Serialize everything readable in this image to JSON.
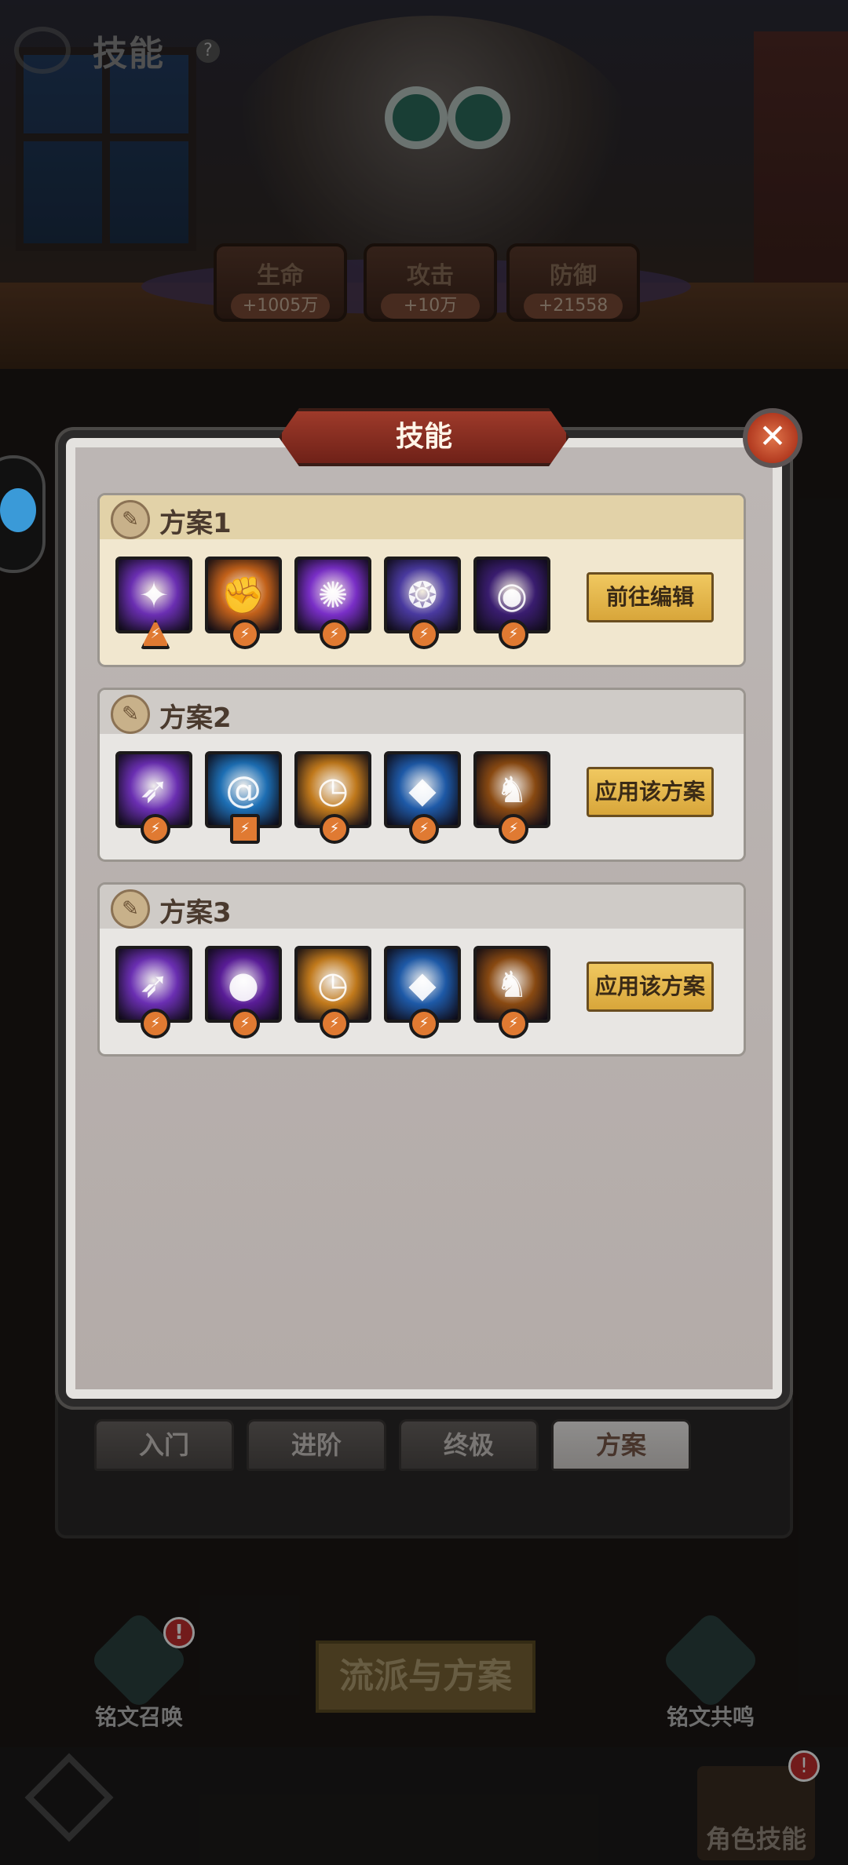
{
  "header": {
    "title": "技能",
    "help_label": "?"
  },
  "stats": [
    {
      "label": "生命",
      "value": "+1005万"
    },
    {
      "label": "攻击",
      "value": "+10万"
    },
    {
      "label": "防御",
      "value": "+21558"
    }
  ],
  "modal": {
    "title": "技能",
    "close_label": "✕",
    "plans": [
      {
        "name": "方案1",
        "action": "前往编辑",
        "active": true,
        "skills": [
          {
            "icon": "star-strike-icon",
            "color": "#6b2fb3",
            "glyph": "✦",
            "tag": "triangle"
          },
          {
            "icon": "flame-fist-icon",
            "color": "#c4621a",
            "glyph": "✊",
            "tag": "circle"
          },
          {
            "icon": "arcane-burst-icon",
            "color": "#7a2fc8",
            "glyph": "✺",
            "tag": "circle"
          },
          {
            "icon": "spirit-orb-icon",
            "color": "#4a3aa0",
            "glyph": "❂",
            "tag": "circle"
          },
          {
            "icon": "void-portal-icon",
            "color": "#3a1d70",
            "glyph": "◉",
            "tag": "circle"
          }
        ]
      },
      {
        "name": "方案2",
        "action": "应用该方案",
        "active": false,
        "skills": [
          {
            "icon": "violet-slash-icon",
            "color": "#6b2fb3",
            "glyph": "➶",
            "tag": "circle"
          },
          {
            "icon": "whirlpool-icon",
            "color": "#1d6fb5",
            "glyph": "@",
            "tag": "square"
          },
          {
            "icon": "golden-clock-icon",
            "color": "#c27a1c",
            "glyph": "◷",
            "tag": "circle"
          },
          {
            "icon": "ice-crystal-icon",
            "color": "#1e5aa8",
            "glyph": "◆",
            "tag": "circle"
          },
          {
            "icon": "shadow-imp-icon",
            "color": "#8a4a12",
            "glyph": "♞",
            "tag": "circle"
          }
        ]
      },
      {
        "name": "方案3",
        "action": "应用该方案",
        "active": false,
        "skills": [
          {
            "icon": "violet-slash-icon",
            "color": "#6b2fb3",
            "glyph": "➶",
            "tag": "circle"
          },
          {
            "icon": "dark-eclipse-icon",
            "color": "#5a1d98",
            "glyph": "●",
            "tag": "circle"
          },
          {
            "icon": "golden-clock-icon",
            "color": "#c27a1c",
            "glyph": "◷",
            "tag": "circle"
          },
          {
            "icon": "ice-crystal-icon",
            "color": "#1e5aa8",
            "glyph": "◆",
            "tag": "circle"
          },
          {
            "icon": "shadow-imp-icon",
            "color": "#8a4a12",
            "glyph": "♞",
            "tag": "circle"
          }
        ]
      }
    ]
  },
  "tabs": [
    "入门",
    "进阶",
    "终极",
    "方案"
  ],
  "active_tab": "方案",
  "bottom": {
    "left_label": "铭文召唤",
    "center_label": "流派与方案",
    "right_label": "铭文共鸣",
    "badge": "!",
    "nav_right_label": "角色技能"
  }
}
